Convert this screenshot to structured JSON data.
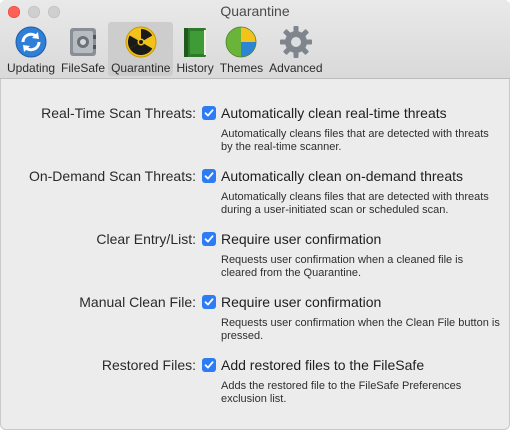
{
  "window": {
    "title": "Quarantine"
  },
  "toolbar": {
    "items": [
      {
        "label": "Updating",
        "icon": "updating-icon",
        "selected": false
      },
      {
        "label": "FileSafe",
        "icon": "filesafe-icon",
        "selected": false
      },
      {
        "label": "Quarantine",
        "icon": "quarantine-icon",
        "selected": true
      },
      {
        "label": "History",
        "icon": "history-icon",
        "selected": false
      },
      {
        "label": "Themes",
        "icon": "themes-icon",
        "selected": false
      },
      {
        "label": "Advanced",
        "icon": "advanced-icon",
        "selected": false
      }
    ]
  },
  "settings": [
    {
      "label": "Real-Time Scan Threats:",
      "option": "Automatically clean real-time threats",
      "checked": true,
      "description": "Automatically cleans files that are detected with threats by the real-time scanner."
    },
    {
      "label": "On-Demand Scan Threats:",
      "option": "Automatically clean on-demand threats",
      "checked": true,
      "description": "Automatically cleans files that are detected with threats during a user-initiated scan or scheduled scan."
    },
    {
      "label": "Clear Entry/List:",
      "option": "Require user confirmation",
      "checked": true,
      "description": "Requests user confirmation when a cleaned file is cleared from the Quarantine."
    },
    {
      "label": "Manual Clean File:",
      "option": "Require user confirmation",
      "checked": true,
      "description": "Requests user confirmation when the Clean File button is pressed."
    },
    {
      "label": "Restored Files:",
      "option": "Add restored files to the FileSafe",
      "checked": true,
      "description": "Adds the restored file to the FileSafe Preferences exclusion list."
    }
  ],
  "colors": {
    "accent": "#2d7cf6",
    "close": "#fe5f57"
  }
}
